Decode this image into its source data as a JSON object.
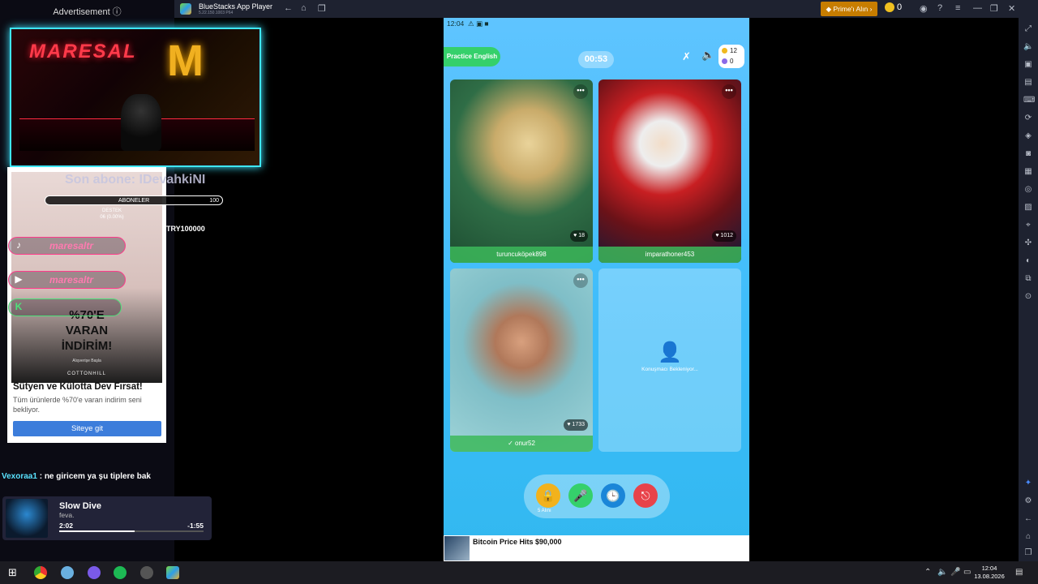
{
  "left": {
    "ad_label": "Advertisement ⓘ",
    "banner": {
      "logo_text": "MARESAL",
      "logo_m": "M"
    },
    "ad": {
      "promo_line1": "%70'E",
      "promo_line2": "VARAN",
      "promo_line3": "İNDİRİM!",
      "promo_sub": "Alışverişe Başla",
      "brand": "COTTONHILL",
      "headline": "Sütyen ve Külotta Dev Fırsat!",
      "body": "Tüm ürünlerde %70'e varan indirim seni bekliyor.",
      "cta": "Siteye git"
    },
    "overlay": {
      "last_sub": "Son abone: IDevahkiNI",
      "subs_label": "ABONELER",
      "subs_count": "100",
      "support_label": "DESTEK",
      "support_value": "06 (0.00%)",
      "try_label": "TRY100000",
      "tiktok": "maresaltr",
      "youtube": "maresaltr"
    },
    "chat": {
      "user": "Vexoraa1",
      "message": " : ne giricem ya şu tiplere bak"
    },
    "music": {
      "title": "Slow Dive",
      "artist": "feva.",
      "elapsed": "2:02",
      "remaining": "-1:55",
      "progress": 0.52
    }
  },
  "bluestacks": {
    "title": "BlueStacks App Player",
    "version": "5.22.150.1003 P64",
    "prime_label": "Prime'ı Alın",
    "coins": "0"
  },
  "phone": {
    "status_time": "12:04",
    "practice_label": "Practice English",
    "timer": "00:53",
    "balance_coins": "12",
    "balance_gems": "0",
    "cards": [
      {
        "name": "turuncuköpek898",
        "likes": "18"
      },
      {
        "name": "imparathoner453",
        "likes": "1012"
      },
      {
        "name": "onur52",
        "likes": "1733"
      }
    ],
    "waiting_text": "Konuşmacı Bekleniyor...",
    "lock_caption": "5 Alını",
    "news_title": "Bitcoin Price Hits $90,000"
  },
  "taskbar": {
    "time": "12:04",
    "date": "13.08.2026"
  },
  "colors": {
    "accent_green": "#35d06b",
    "phone_bg": "#3bbcfa",
    "prime": "#c77d00"
  }
}
